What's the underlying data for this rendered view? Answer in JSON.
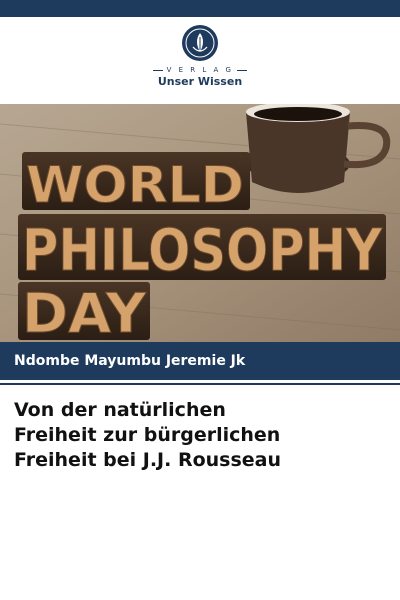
{
  "publisher": {
    "verlag_label": "V E R L A G",
    "imprint_name": "Unser Wissen"
  },
  "cover_image": {
    "words": [
      "WORLD",
      "PHILOSOPHY",
      "DAY"
    ]
  },
  "author": "Ndombe Mayumbu Jeremie Jk",
  "title_lines": [
    "Von der natürlichen",
    "Freiheit zur bürgerlichen",
    "Freiheit bei J.J. Rousseau"
  ],
  "colors": {
    "brand": "#1e3a5c",
    "title_text": "#111111"
  }
}
